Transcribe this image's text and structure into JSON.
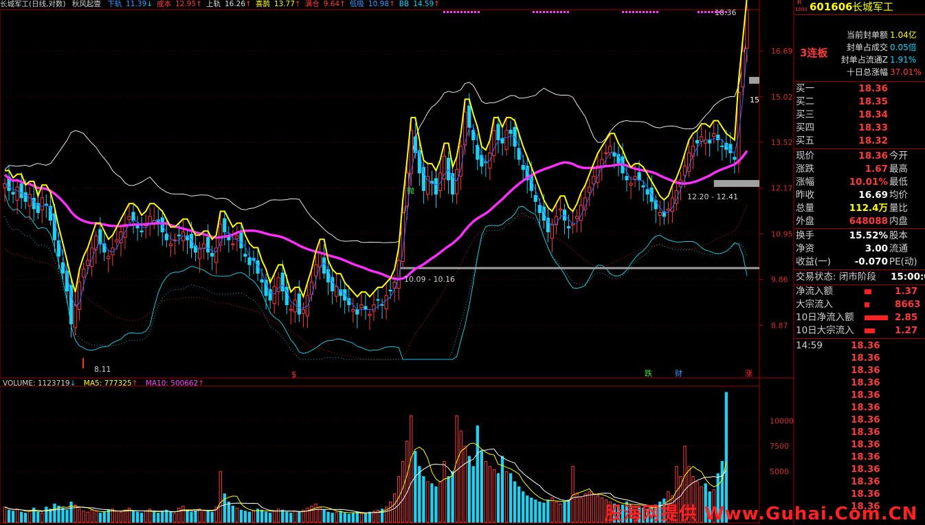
{
  "header": {
    "title": "长城军工(日线,对数)",
    "indicator": "秋风起壹",
    "items": [
      {
        "label": "下轨",
        "value": "11.39",
        "arrow": "↓",
        "color": "#3a9bff"
      },
      {
        "label": "成本",
        "value": "12.95",
        "arrow": "↑",
        "color": "#ff3c3c"
      },
      {
        "label": "上轨",
        "value": "16.26",
        "arrow": "↑",
        "color": "#e0e0e0"
      },
      {
        "label": "喜鹊",
        "value": "13.77",
        "arrow": "↑",
        "color": "#ffff00"
      },
      {
        "label": "满仓",
        "value": "9.64",
        "arrow": "↑",
        "color": "#ff3c3c"
      },
      {
        "label": "低吸",
        "value": "10.98",
        "arrow": "↑",
        "color": "#3a9bff"
      },
      {
        "label": "BB",
        "value": "14.59",
        "arrow": "↑",
        "color": "#00d8ff"
      }
    ]
  },
  "price_axis": [
    "16.69",
    "15.02",
    "13.52",
    "12.17",
    "10.95",
    "9.86",
    "8.87"
  ],
  "annotations": {
    "top_high": "18.36",
    "low_mark": "8.11",
    "zone1": "10.09 - 10.16",
    "zone2": "12.20 - 12.41",
    "buy_signal": "抛",
    "mark_s": "$",
    "mark_die": "跌",
    "mark_cai": "财",
    "mark_zhang": "涨",
    "label_15": "15"
  },
  "volume_header": {
    "volume_label": "VOLUME: 1123719",
    "volume_arrow": "↓",
    "ma5_label": "MA5: 777325",
    "ma5_arrow": "↑",
    "ma10_label": "MA10: 500662",
    "ma10_arrow": "↑"
  },
  "volume_axis": [
    "10000",
    "7500",
    "5000"
  ],
  "panel": {
    "marker": "R",
    "marker_sub": "1000",
    "code": "601606",
    "name": "长城军工",
    "board": "3连板",
    "seal": [
      {
        "label": "当前封单额",
        "value": "1.04亿",
        "color": "#ffff00"
      },
      {
        "label": "封单占成交",
        "value": "0.05倍",
        "color": "#00d8ff"
      },
      {
        "label": "封单占流通Z",
        "value": "1.91%",
        "color": "#00d8ff"
      },
      {
        "label": "十日总涨幅",
        "value": "37.01%",
        "color": "#ff3c3c"
      }
    ],
    "bids": [
      {
        "label": "买一",
        "value": "18.36"
      },
      {
        "label": "买二",
        "value": "18.35"
      },
      {
        "label": "买三",
        "value": "18.34"
      },
      {
        "label": "买四",
        "value": "18.33"
      },
      {
        "label": "买五",
        "value": "18.32"
      }
    ],
    "quote": [
      {
        "label": "现价",
        "value": "18.36",
        "label2": "今开",
        "color": "#ff3c3c"
      },
      {
        "label": "涨跌",
        "value": "1.67",
        "label2": "最高",
        "color": "#ff3c3c"
      },
      {
        "label": "涨幅",
        "value": "10.01%",
        "label2": "最低",
        "color": "#ff3c3c"
      },
      {
        "label": "昨收",
        "value": "16.69",
        "label2": "均价",
        "color": "#ffffff"
      },
      {
        "label": "总量",
        "value": "112.4万",
        "label2": "量比",
        "color": "#ffff00"
      },
      {
        "label": "外盘",
        "value": "648088",
        "label2": "内盘",
        "color": "#ff3c3c"
      }
    ],
    "quote2": [
      {
        "label": "换手",
        "value": "15.52%",
        "label2": "股本",
        "color": "#ffffff"
      },
      {
        "label": "净资",
        "value": "3.00",
        "label2": "流通",
        "color": "#ffffff"
      },
      {
        "label": "收益(一)",
        "value": "-0.070",
        "label2": "PE(动)",
        "color": "#ffffff"
      }
    ],
    "trade_status": "交易状态: 闭市阶段",
    "trade_time": "15:00:0",
    "flows": [
      {
        "label": "净流入额",
        "value": "1.37",
        "bar": 0.3
      },
      {
        "label": "大宗流入",
        "value": "8663",
        "bar": 0.2
      },
      {
        "label": "10日净流入额",
        "value": "2.85",
        "bar": 1.0
      },
      {
        "label": "10日大宗流入",
        "value": "1.27",
        "bar": 0.45
      }
    ],
    "tick_time": "14:59",
    "ticks": [
      "18.36",
      "18.36",
      "18.36",
      "18.36",
      "18.36",
      "18.36",
      "18.36",
      "18.36",
      "18.36",
      "18.36",
      "18.36",
      "18.36",
      "18.36",
      "18.36"
    ]
  },
  "watermark": "股海网提供 Www.Guhai.Com.CN",
  "chart_data": {
    "type": "candlestick",
    "y_scale": "log",
    "ylim": [
      8.11,
      18.36
    ],
    "close": [
      12.3,
      12.1,
      12.0,
      12.2,
      11.9,
      11.8,
      12.0,
      11.6,
      11.5,
      11.9,
      11.7,
      11.3,
      10.8,
      10.4,
      10.0,
      9.6,
      8.9,
      9.3,
      9.8,
      10.1,
      10.3,
      10.6,
      10.9,
      10.7,
      10.5,
      10.4,
      10.6,
      10.8,
      11.0,
      11.2,
      11.4,
      11.3,
      11.1,
      11.0,
      11.2,
      11.4,
      11.3,
      11.2,
      11.0,
      10.8,
      10.7,
      10.8,
      10.9,
      11.0,
      10.8,
      10.6,
      10.5,
      10.6,
      10.7,
      10.5,
      10.4,
      10.6,
      11.2,
      11.0,
      10.8,
      10.7,
      10.9,
      10.6,
      10.4,
      10.2,
      10.3,
      10.0,
      9.8,
      9.5,
      9.4,
      9.7,
      9.9,
      9.6,
      9.3,
      9.2,
      9.4,
      9.1,
      9.2,
      9.5,
      9.8,
      10.2,
      10.5,
      10.0,
      9.8,
      9.6,
      9.7,
      9.5,
      9.4,
      9.3,
      9.2,
      9.1,
      9.3,
      9.2,
      9.1,
      9.3,
      9.4,
      9.3,
      9.5,
      9.6,
      9.8,
      10.3,
      11.5,
      12.6,
      13.9,
      13.2,
      12.6,
      12.1,
      12.5,
      12.3,
      12.0,
      12.6,
      13.1,
      12.4,
      12.0,
      12.7,
      13.4,
      14.5,
      14.0,
      13.6,
      13.0,
      12.8,
      12.9,
      13.2,
      13.9,
      13.6,
      13.5,
      13.9,
      13.8,
      13.4,
      13.0,
      12.7,
      12.4,
      12.1,
      11.8,
      11.5,
      11.3,
      11.0,
      11.2,
      11.4,
      11.6,
      11.3,
      11.1,
      11.2,
      11.4,
      11.7,
      11.9,
      12.2,
      12.5,
      12.8,
      13.0,
      13.2,
      13.4,
      13.1,
      12.9,
      12.6,
      12.4,
      12.3,
      12.5,
      12.4,
      12.2,
      12.0,
      11.8,
      11.6,
      11.5,
      11.4,
      11.6,
      11.9,
      12.1,
      12.4,
      12.8,
      13.2,
      13.4,
      13.5,
      13.7,
      13.6,
      13.5,
      13.8,
      13.6,
      13.4,
      13.3,
      13.2,
      13.0,
      15.17,
      16.69,
      18.36
    ],
    "volume": [
      1500,
      1200,
      1100,
      1300,
      1000,
      900,
      1100,
      1400,
      1000,
      900,
      1500,
      1300,
      1800,
      1600,
      1400,
      1200,
      2000,
      1700,
      1300,
      1100,
      1000,
      1200,
      1100,
      900,
      1000,
      1200,
      1300,
      1100,
      1000,
      1200,
      1400,
      1100,
      1000,
      900,
      1100,
      1300,
      1000,
      900,
      1100,
      1200,
      1000,
      900,
      1400,
      1600,
      1200,
      1000,
      1100,
      1300,
      1200,
      1100,
      1000,
      1500,
      5000,
      2800,
      2000,
      1600,
      1400,
      1200,
      1100,
      1000,
      1100,
      1300,
      1200,
      1000,
      900,
      1100,
      1300,
      1200,
      1000,
      900,
      1100,
      1000,
      1200,
      1400,
      1600,
      1800,
      1500,
      1200,
      1000,
      900,
      1000,
      1100,
      900,
      800,
      900,
      1000,
      900,
      800,
      1000,
      1100,
      1200,
      1300,
      1500,
      2000,
      2800,
      4500,
      6000,
      8000,
      10500,
      7000,
      5500,
      4500,
      4000,
      3800,
      3500,
      4000,
      6000,
      4500,
      5000,
      10500,
      9000,
      7500,
      6500,
      5500,
      9500,
      7000,
      6000,
      5500,
      5200,
      4800,
      6500,
      5000,
      4800,
      4000,
      3500,
      3000,
      2600,
      2400,
      2200,
      2000,
      1900,
      2200,
      2400,
      2000,
      1800,
      2000,
      2200,
      5500,
      2800,
      2400,
      2800,
      3000,
      2800,
      2600,
      2400,
      2200,
      2000,
      1800,
      1600,
      1700,
      2000,
      1800,
      1600,
      1500,
      1400,
      1300,
      1500,
      1700,
      2000,
      2300,
      3000,
      2600,
      5500,
      4500,
      7500,
      5500,
      4500,
      4000,
      3500,
      3800,
      3000,
      3200,
      4800,
      6000,
      12800
    ]
  }
}
